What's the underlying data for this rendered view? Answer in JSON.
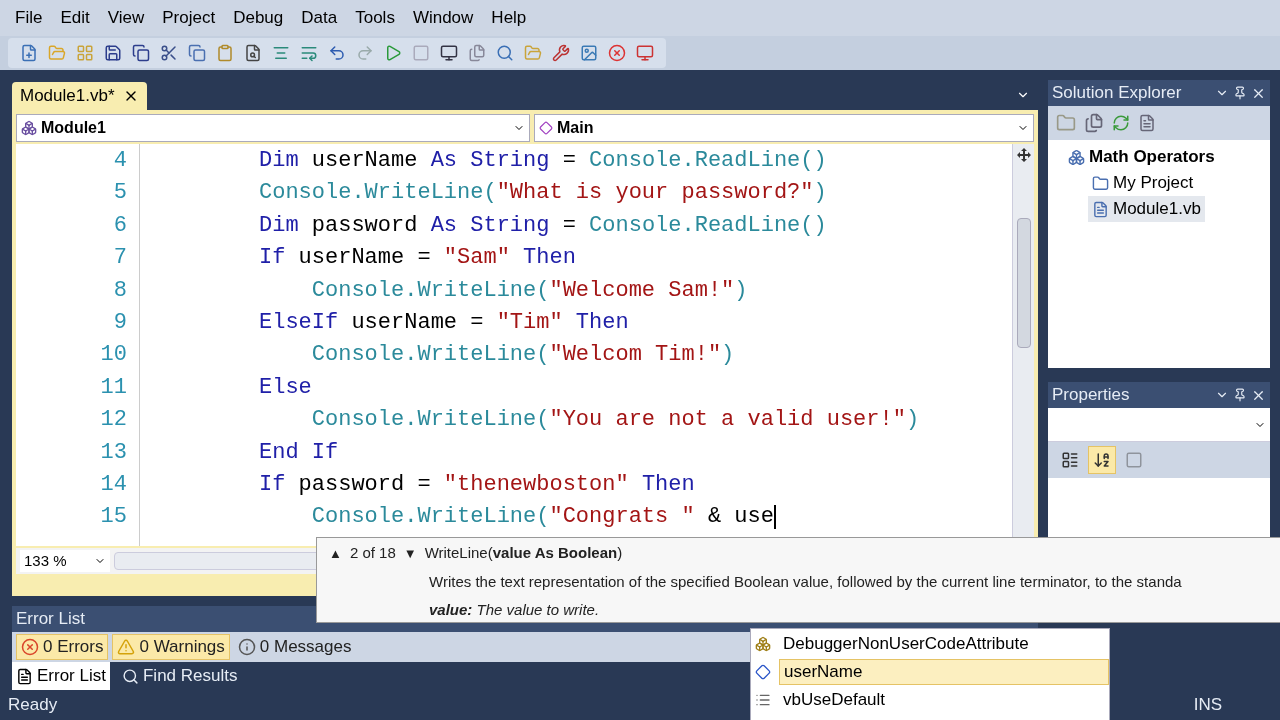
{
  "menu": [
    "File",
    "Edit",
    "View",
    "Project",
    "Debug",
    "Data",
    "Tools",
    "Window",
    "Help"
  ],
  "document_tab": {
    "title": "Module1.vb*",
    "selected": true
  },
  "navigation": {
    "type_combo": "Module1",
    "member_combo": "Main"
  },
  "code_lines": [
    {
      "number": "4",
      "tokens": [
        {
          "kind": "keyword",
          "text": "Dim"
        },
        {
          "kind": "plain",
          "text": " userName "
        },
        {
          "kind": "keyword",
          "text": "As String"
        },
        {
          "kind": "plain",
          "text": " = "
        },
        {
          "kind": "member",
          "text": "Console.ReadLine()"
        }
      ]
    },
    {
      "number": "5",
      "tokens": [
        {
          "kind": "member",
          "text": "Console.WriteLine("
        },
        {
          "kind": "string",
          "text": "\"What is your password?\""
        },
        {
          "kind": "member",
          "text": ")"
        }
      ]
    },
    {
      "number": "6",
      "tokens": [
        {
          "kind": "keyword",
          "text": "Dim"
        },
        {
          "kind": "plain",
          "text": " password "
        },
        {
          "kind": "keyword",
          "text": "As String"
        },
        {
          "kind": "plain",
          "text": " = "
        },
        {
          "kind": "member",
          "text": "Console.ReadLine()"
        }
      ]
    },
    {
      "number": "7",
      "tokens": [
        {
          "kind": "keyword",
          "text": "If"
        },
        {
          "kind": "plain",
          "text": " userName = "
        },
        {
          "kind": "string",
          "text": "\"Sam\""
        },
        {
          "kind": "keyword",
          "text": " Then"
        }
      ]
    },
    {
      "number": "8",
      "tokens": [
        {
          "kind": "member",
          "text": "    Console.WriteLine("
        },
        {
          "kind": "string",
          "text": "\"Welcome Sam!\""
        },
        {
          "kind": "member",
          "text": ")"
        }
      ]
    },
    {
      "number": "9",
      "tokens": [
        {
          "kind": "keyword",
          "text": "ElseIf"
        },
        {
          "kind": "plain",
          "text": " userName = "
        },
        {
          "kind": "string",
          "text": "\"Tim\""
        },
        {
          "kind": "keyword",
          "text": " Then"
        }
      ]
    },
    {
      "number": "10",
      "tokens": [
        {
          "kind": "member",
          "text": "    Console.WriteLine("
        },
        {
          "kind": "string",
          "text": "\"Welcom Tim!\""
        },
        {
          "kind": "member",
          "text": ")"
        }
      ]
    },
    {
      "number": "11",
      "tokens": [
        {
          "kind": "keyword",
          "text": "Else"
        }
      ]
    },
    {
      "number": "12",
      "tokens": [
        {
          "kind": "member",
          "text": "    Console.WriteLine("
        },
        {
          "kind": "string",
          "text": "\"You are not a valid user!\""
        },
        {
          "kind": "member",
          "text": ")"
        }
      ]
    },
    {
      "number": "13",
      "tokens": [
        {
          "kind": "keyword",
          "text": "End If"
        }
      ]
    },
    {
      "number": "14",
      "tokens": [
        {
          "kind": "keyword",
          "text": "If"
        },
        {
          "kind": "plain",
          "text": " password = "
        },
        {
          "kind": "string",
          "text": "\"thenewboston\""
        },
        {
          "kind": "keyword",
          "text": " Then"
        }
      ]
    },
    {
      "number": "15",
      "caret": true,
      "tokens": [
        {
          "kind": "member",
          "text": "    Console.WriteLine("
        },
        {
          "kind": "string",
          "text": "\"Congrats \""
        },
        {
          "kind": "plain",
          "text": " & use"
        }
      ]
    }
  ],
  "zoom": "133 %",
  "tooltip": {
    "previous": "▲",
    "counter": "2 of 18",
    "next": "▼",
    "signature": "WriteLine(**value As Boolean**)",
    "description": "Writes the text representation of the specified Boolean value, followed by the current line terminator, to the standa",
    "parameter": "**value:** The value to write."
  },
  "completion_list": [
    {
      "kind": "attribute",
      "label": "DebuggerNonUserCodeAttribute",
      "selected": false
    },
    {
      "kind": "field",
      "label": "userName",
      "selected": true
    },
    {
      "kind": "enum",
      "label": "vbUseDefault",
      "selected": false
    }
  ],
  "error_list": {
    "title": "Error List",
    "filters": [
      {
        "kind": "errors",
        "label": "0 Errors",
        "selected": true
      },
      {
        "kind": "warnings",
        "label": "0 Warnings",
        "selected": true
      },
      {
        "kind": "messages",
        "label": "0 Messages",
        "selected": false
      }
    ]
  },
  "bottom_tabs": [
    {
      "kind": "errors",
      "label": "Error List",
      "selected": true
    },
    {
      "kind": "find",
      "label": "Find Results",
      "selected": false
    }
  ],
  "solution_explorer": {
    "title": "Solution Explorer",
    "tree": [
      {
        "kind": "project",
        "label": "Math Operators",
        "selected": false,
        "children": [
          {
            "kind": "folder",
            "label": "My Project",
            "selected": false
          },
          {
            "kind": "file",
            "label": "Module1.vb",
            "selected": true
          }
        ]
      }
    ]
  },
  "properties": {
    "title": "Properties",
    "buttons": [
      {
        "kind": "categorized",
        "selected": false,
        "disabled": false
      },
      {
        "kind": "alphabetical",
        "selected": true,
        "disabled": false
      },
      {
        "kind": "pages",
        "selected": false,
        "disabled": true
      }
    ]
  },
  "status_bar": {
    "message": "Ready",
    "mode": "INS"
  }
}
